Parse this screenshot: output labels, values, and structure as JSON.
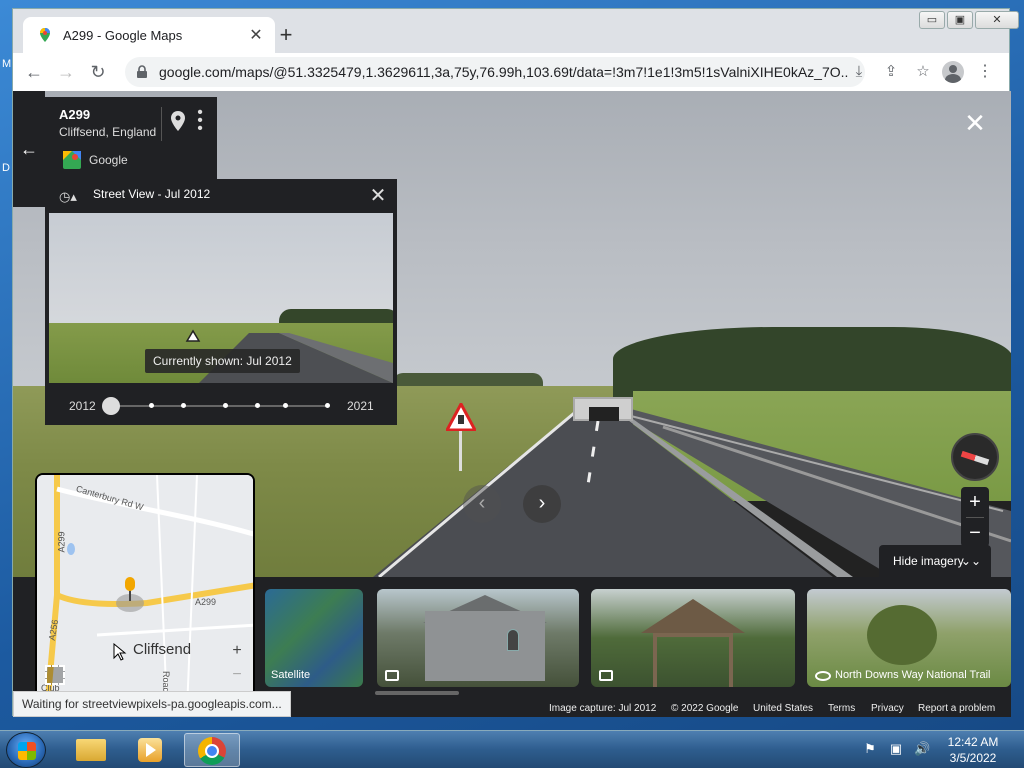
{
  "browser": {
    "tab_title": "A299 - Google Maps",
    "new_tab": "+",
    "url": "google.com/maps/@51.3325479,1.3629611,3a,75y,76.99h,103.69t/data=!3m7!1e1!3m5!1sValniXIHE0kAz_7O...",
    "window_controls": {
      "minimize": "▭",
      "maximize": "▣",
      "close": "✕"
    }
  },
  "street_view": {
    "close_label": "✕"
  },
  "info_card": {
    "road": "A299",
    "place": "Cliffsend, England",
    "source": "Google"
  },
  "time_panel": {
    "header": "Street View - Jul 2012",
    "tooltip": "Currently shown: Jul 2012",
    "start_year": "2012",
    "end_year": "2021",
    "selected_fraction": 0
  },
  "controls": {
    "zoom_in": "+",
    "zoom_out": "−",
    "hide_imagery": "Hide imagery"
  },
  "thumbnails": [
    {
      "caption": "Satellite"
    },
    {
      "caption": ""
    },
    {
      "caption": ""
    },
    {
      "caption": "North Downs Way National Trail"
    }
  ],
  "minimap": {
    "labels": {
      "canterbury": "Canterbury Rd W",
      "a299_left": "A299",
      "a299_right": "A299",
      "a256": "A256",
      "town": "Cliffsend",
      "roads": "Roads",
      "club": "Club"
    },
    "zoom_in": "+",
    "zoom_out": "−"
  },
  "footer": {
    "image_capture": "Image capture: Jul 2012",
    "copyright": "© 2022 Google",
    "country": "United States",
    "terms": "Terms",
    "privacy": "Privacy",
    "report": "Report a problem"
  },
  "status_bar": "Waiting for streetviewpixels-pa.googleapis.com...",
  "desktop": {
    "glyph_m": "M",
    "glyph_d": "D"
  },
  "taskbar": {
    "time": "12:42 AM",
    "date": "3/5/2022"
  }
}
